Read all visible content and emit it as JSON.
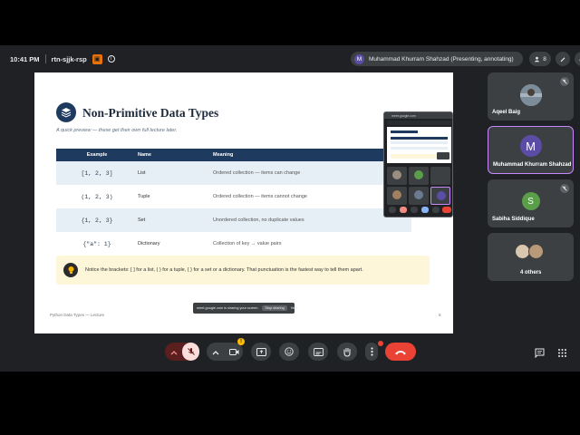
{
  "topbar": {
    "time": "10:41 PM",
    "meeting_code": "rtn-sjjk-rsp",
    "presenter_initial": "M",
    "presenter_status": "Muhammad Khurram Shahzad (Presenting, annotating)",
    "participant_count": "8"
  },
  "slide": {
    "title": "Non-Primitive Data Types",
    "subtitle": "A quick preview — these get their own full lecture later.",
    "headers": [
      "Example",
      "Name",
      "Meaning"
    ],
    "rows": [
      {
        "example": "[1, 2, 3]",
        "name": "List",
        "meaning": "Ordered collection — items can change"
      },
      {
        "example": "(1, 2, 3)",
        "name": "Tuple",
        "meaning": "Ordered collection — items cannot change"
      },
      {
        "example": "{1, 2, 3}",
        "name": "Set",
        "meaning": "Unordered collection, no duplicate values"
      },
      {
        "example": "{\"a\": 1}",
        "name": "Dictionary",
        "meaning": "Collection of key → value pairs"
      }
    ],
    "note": "Notice the brackets: [ ] for a list, ( ) for a tuple, { } for a set or a dictionary. That punctuation is the fastest way to tell them apart.",
    "footer": "Python Data Types — Lecture",
    "page": "5"
  },
  "share_bar": {
    "text": "meet.google.com is sharing your screen.",
    "stop_label": "Stop sharing",
    "hide_label": "Hide"
  },
  "mini_preview": {
    "url": "meet.google.com"
  },
  "participants": [
    {
      "name": "Aqeel Baig"
    },
    {
      "name": "Muhammad Khurram Shahzad",
      "initial": "M"
    },
    {
      "name": "Sabiha Siddique",
      "initial": "S"
    },
    {
      "name": "4 others"
    }
  ],
  "controls": {
    "notification_badge": "!"
  },
  "colors": {
    "accent_purple": "#5b4ca6",
    "header_navy": "#1e3a5f",
    "green_avatar": "#5a9e4a",
    "end_call_red": "#ea4335"
  }
}
